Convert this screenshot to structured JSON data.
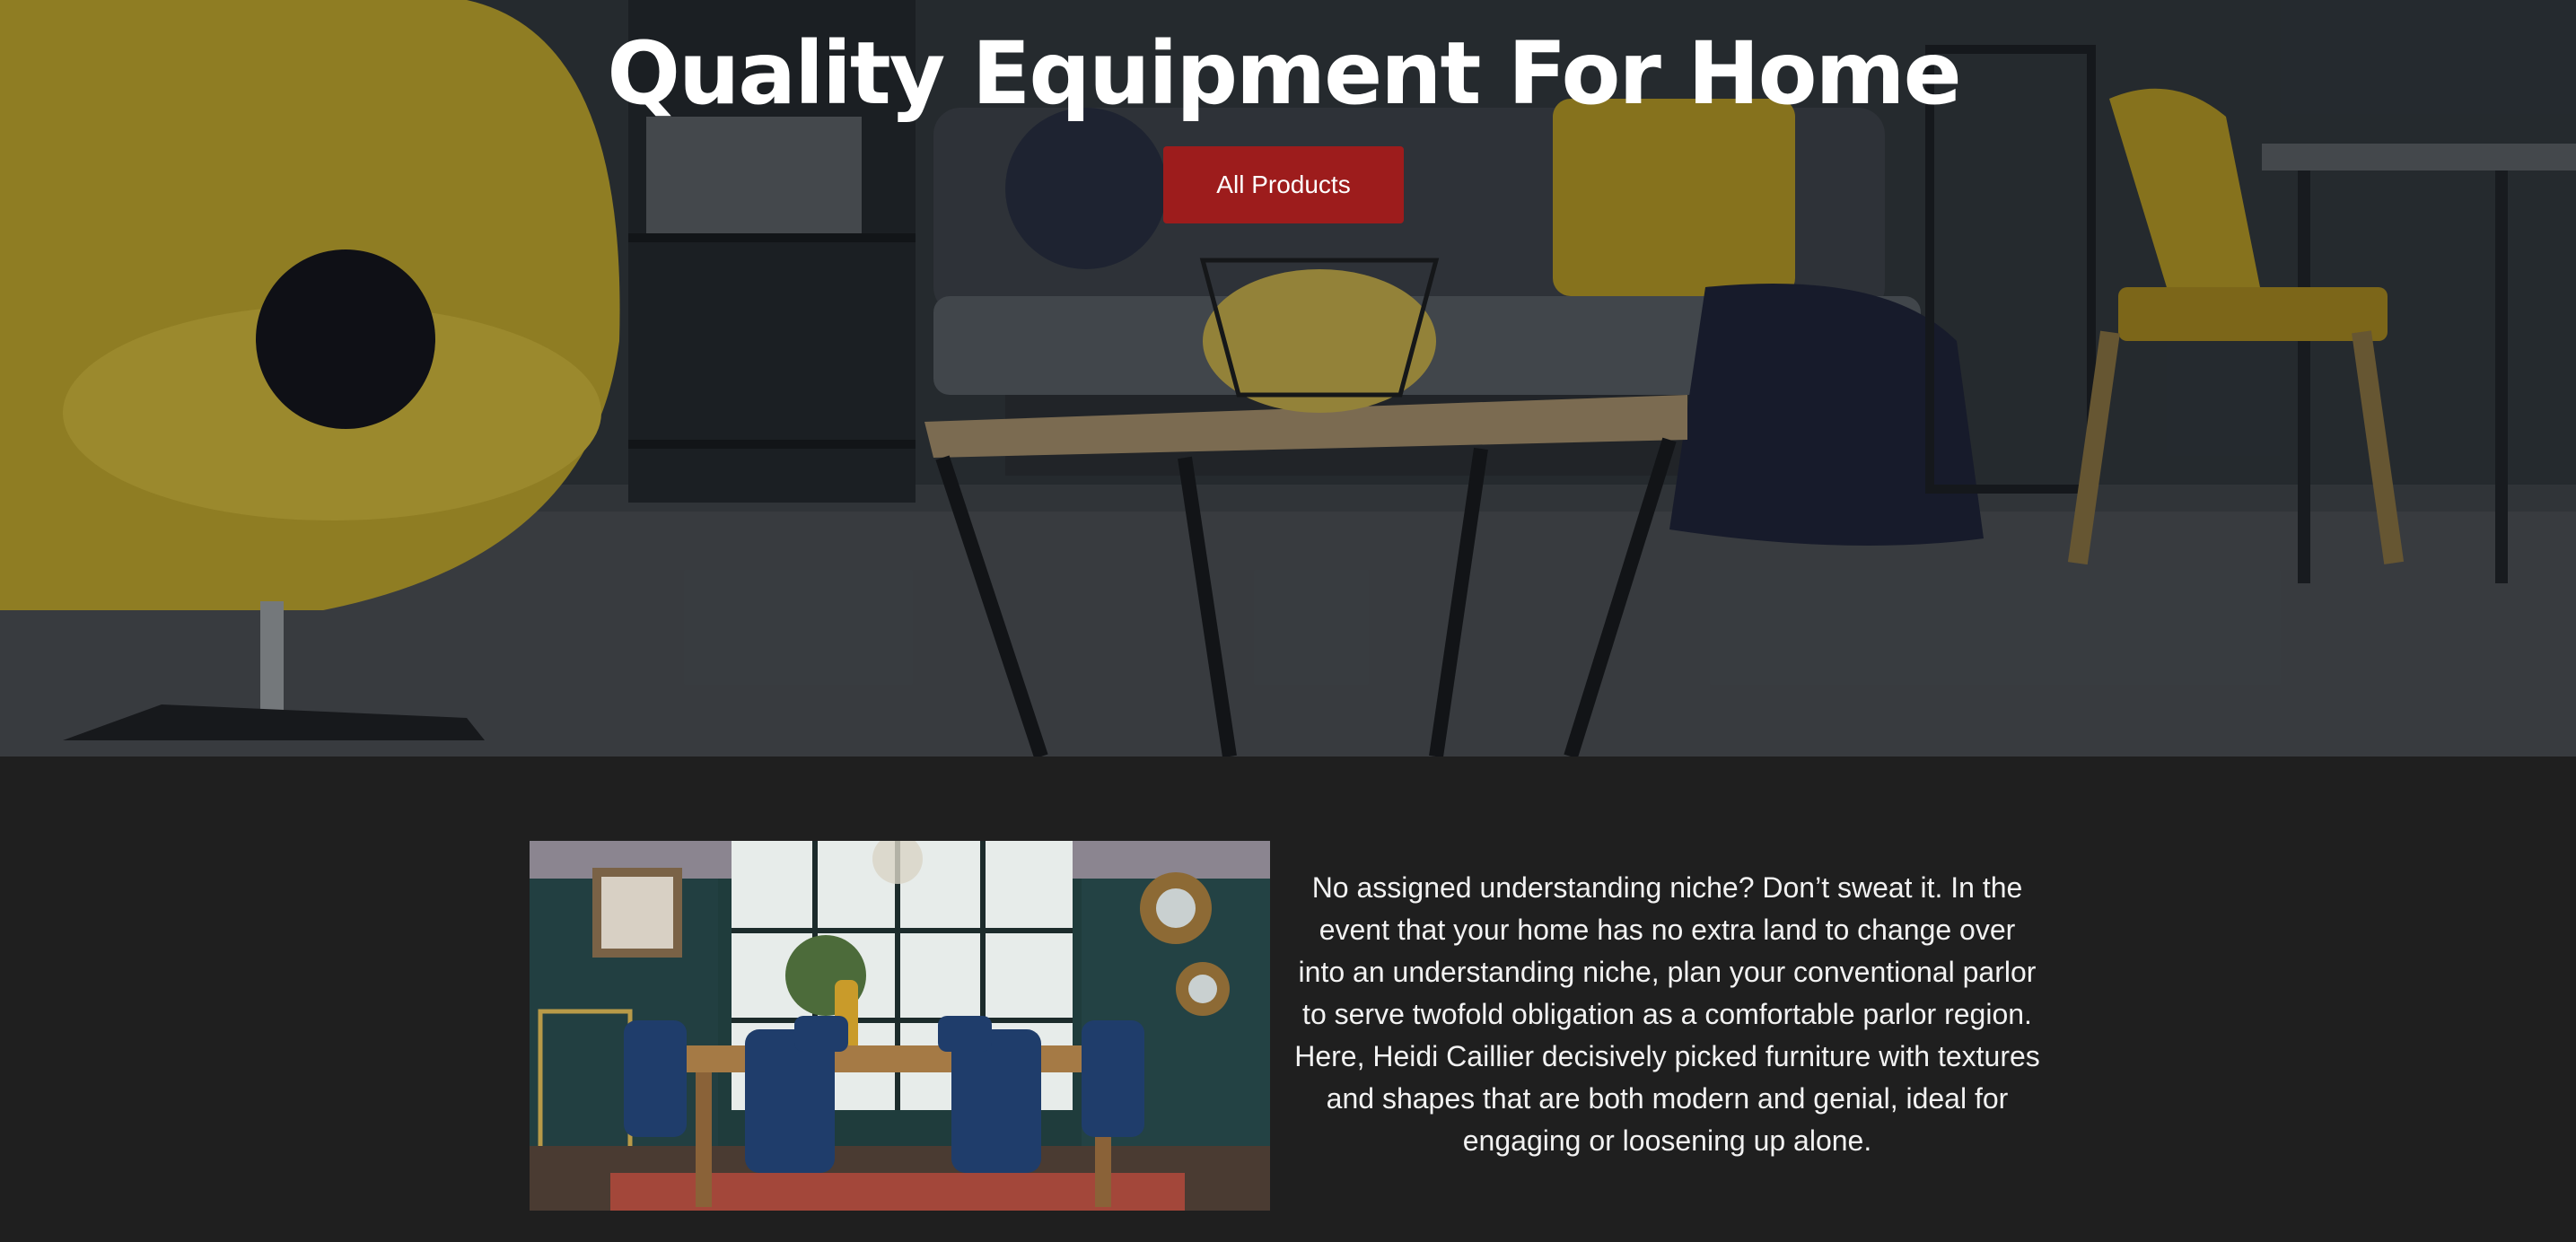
{
  "hero": {
    "title": "Quality Equipment For Home",
    "button_label": "All Products",
    "button_color": "#9d1c1c"
  },
  "feature": {
    "body": "No assigned understanding niche? Don’t sweat it. In the event that your home has no extra land to change over into an understanding niche, plan your conventional parlor to serve twofold obligation as a comfortable parlor region. Here, Heidi Caillier decisively picked furniture with textures and shapes that are both modern and genial, ideal for engaging or loosening up alone."
  },
  "colors": {
    "page_background": "#1f1f1f",
    "text": "#f2f2f2"
  }
}
